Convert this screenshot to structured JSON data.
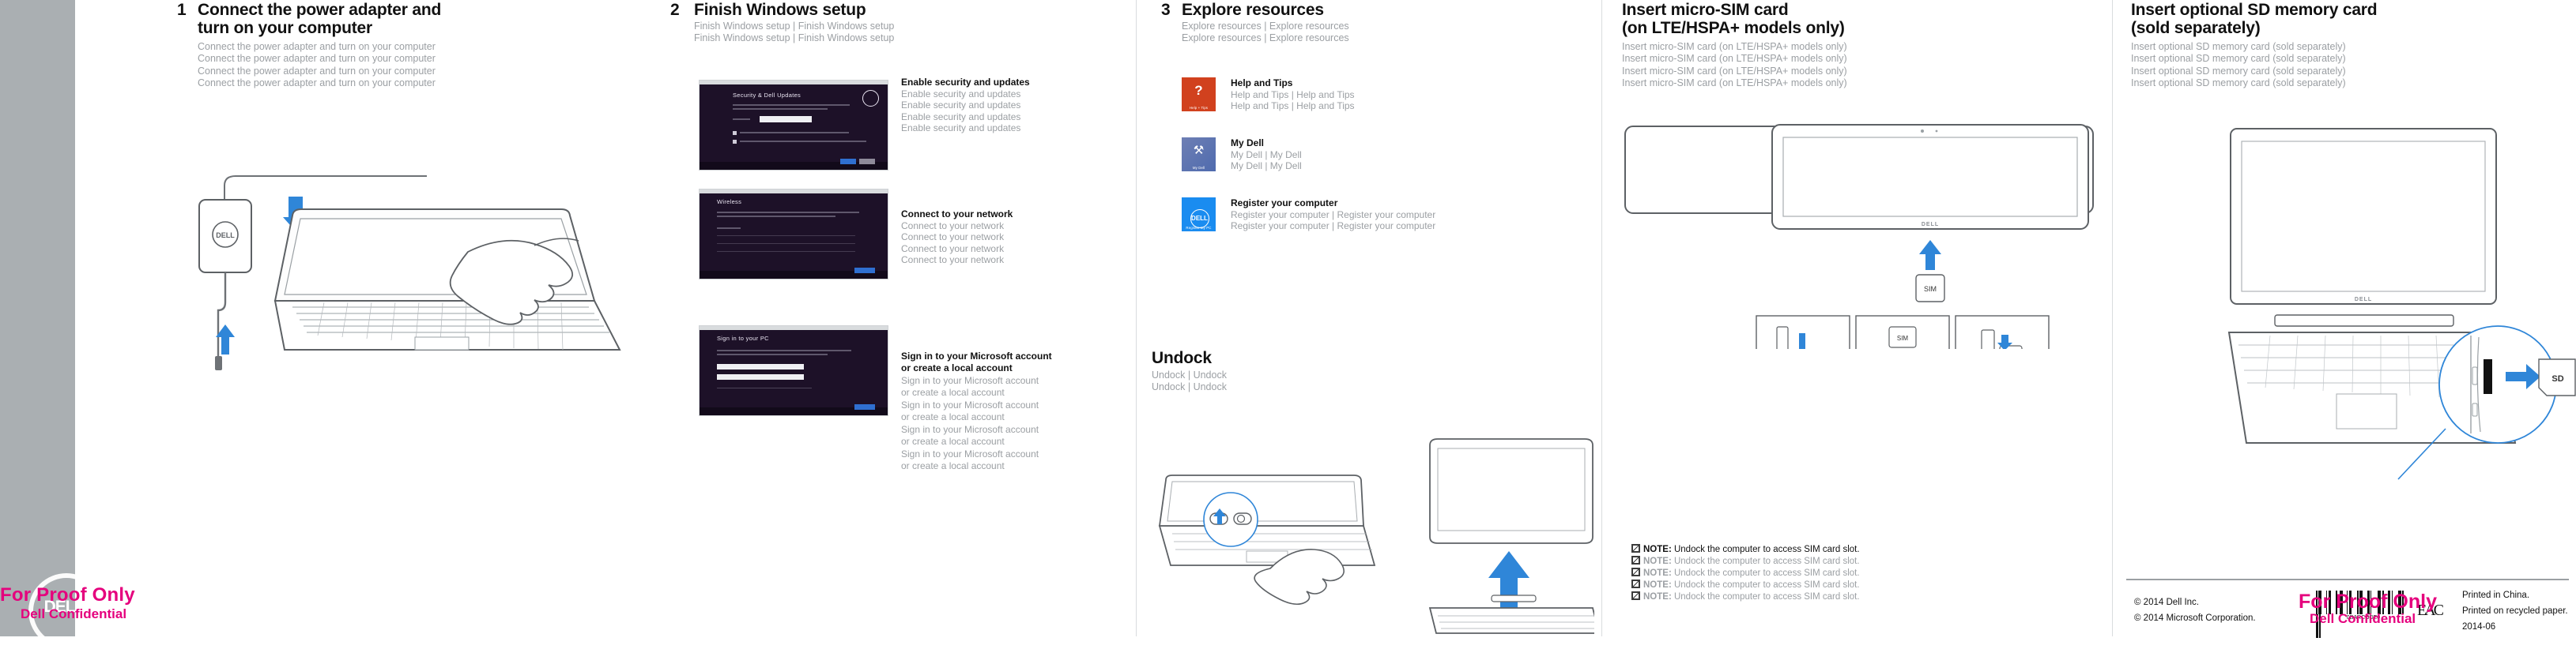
{
  "proof_watermark": {
    "line1": "For Proof Only",
    "line2": "Dell Confidential",
    "logo_text": "DELL"
  },
  "columns": [
    {
      "number": "1",
      "title_line1": "Connect the power adapter and",
      "title_line2": "turn on your computer",
      "sub_lines": [
        "Connect the power adapter and turn on your computer",
        "Connect the power adapter and turn on your computer",
        "Connect the power adapter and turn on your computer",
        "Connect the power adapter and turn on your computer"
      ]
    },
    {
      "number": "2",
      "title_line1": "Finish Windows setup",
      "sub_lines": [
        "Finish Windows setup  |  Finish Windows setup",
        "Finish Windows setup  |  Finish Windows setup"
      ],
      "shots": [
        {
          "screen_title": "Security & Dell Updates",
          "caption_bold": "Enable security and updates",
          "caption_grey": [
            "Enable security and updates",
            "Enable security and updates",
            "Enable security and updates",
            "Enable security and updates"
          ]
        },
        {
          "screen_title": "Wireless",
          "caption_bold": "Connect to your network",
          "caption_grey": [
            "Connect to your network",
            "Connect to your network",
            "Connect to your network",
            "Connect to your network"
          ]
        },
        {
          "screen_title": "Sign in to your PC",
          "caption_bold_l1": "Sign in to your Microsoft account",
          "caption_bold_l2": "or create a local account",
          "caption_grey": [
            "Sign in to your Microsoft account",
            "or create a local account",
            "Sign in to your Microsoft account",
            "or create a local account",
            "Sign in to your Microsoft account",
            "or create a local account",
            "Sign in to your Microsoft account",
            "or create a local account"
          ]
        }
      ]
    },
    {
      "number": "3",
      "title_line1": "Explore resources",
      "sub_lines": [
        "Explore resources  |  Explore resources",
        "Explore resources  |  Explore resources"
      ],
      "tiles": [
        {
          "icon": "help-tips-tile-icon",
          "tile_label": "Help + Tips",
          "color": "#d1411e",
          "glyph": "?",
          "caption_bold": "Help and Tips",
          "caption_grey": [
            "Help and Tips  |  Help and Tips",
            "Help and Tips  |  Help and Tips"
          ]
        },
        {
          "icon": "my-dell-tile-icon",
          "tile_label": "My Dell",
          "color": "#5e7ab4",
          "glyph": "⚒",
          "caption_bold": "My Dell",
          "caption_grey": [
            "My Dell  |  My Dell",
            "My Dell  |  My Dell"
          ]
        },
        {
          "icon": "register-my-pc-tile-icon",
          "tile_label": "Register My PC",
          "color": "#1a8cf0",
          "glyph": "DELL",
          "caption_bold": "Register your computer",
          "caption_grey": [
            "Register your computer  |  Register your computer",
            "Register your computer  |  Register your computer"
          ]
        }
      ],
      "undock": {
        "title": "Undock",
        "sub_lines": [
          "Undock  |  Undock",
          "Undock  |  Undock"
        ]
      }
    },
    {
      "title_line1": "Insert micro-SIM card",
      "title_line2": "(on LTE/HSPA+ models only)",
      "sub_lines": [
        "Insert micro-SIM card (on LTE/HSPA+ models only)",
        "Insert micro-SIM card (on LTE/HSPA+ models only)",
        "Insert micro-SIM card (on LTE/HSPA+ models only)",
        "Insert micro-SIM card (on LTE/HSPA+ models only)"
      ],
      "sim_label": "SIM",
      "tablet_brand": "DELL",
      "notes": [
        "Undock the computer to access SIM card slot.",
        "Undock the computer to access SIM card slot.",
        "Undock the computer to access SIM card slot.",
        "Undock the computer to access SIM card slot.",
        "Undock the computer to access SIM card slot."
      ],
      "note_prefix": "NOTE:"
    },
    {
      "title_line1": "Insert optional SD memory card",
      "title_line2": "(sold separately)",
      "sub_lines": [
        "Insert optional SD memory card (sold separately)",
        "Insert optional SD memory card (sold separately)",
        "Insert optional SD memory card (sold separately)",
        "Insert optional SD memory card (sold separately)"
      ],
      "sd_label": "SD",
      "laptop_brand": "DELL"
    }
  ],
  "footer": {
    "copyright_dell": "© 2014 Dell Inc.",
    "copyright_ms": "© 2014 Microsoft Corporation.",
    "barcode_text": "0BARCODE0",
    "eac_mark": "EAC",
    "printed_in": "Printed in China.",
    "recycled": "Printed on recycled paper.",
    "date_code": "2014-06"
  }
}
